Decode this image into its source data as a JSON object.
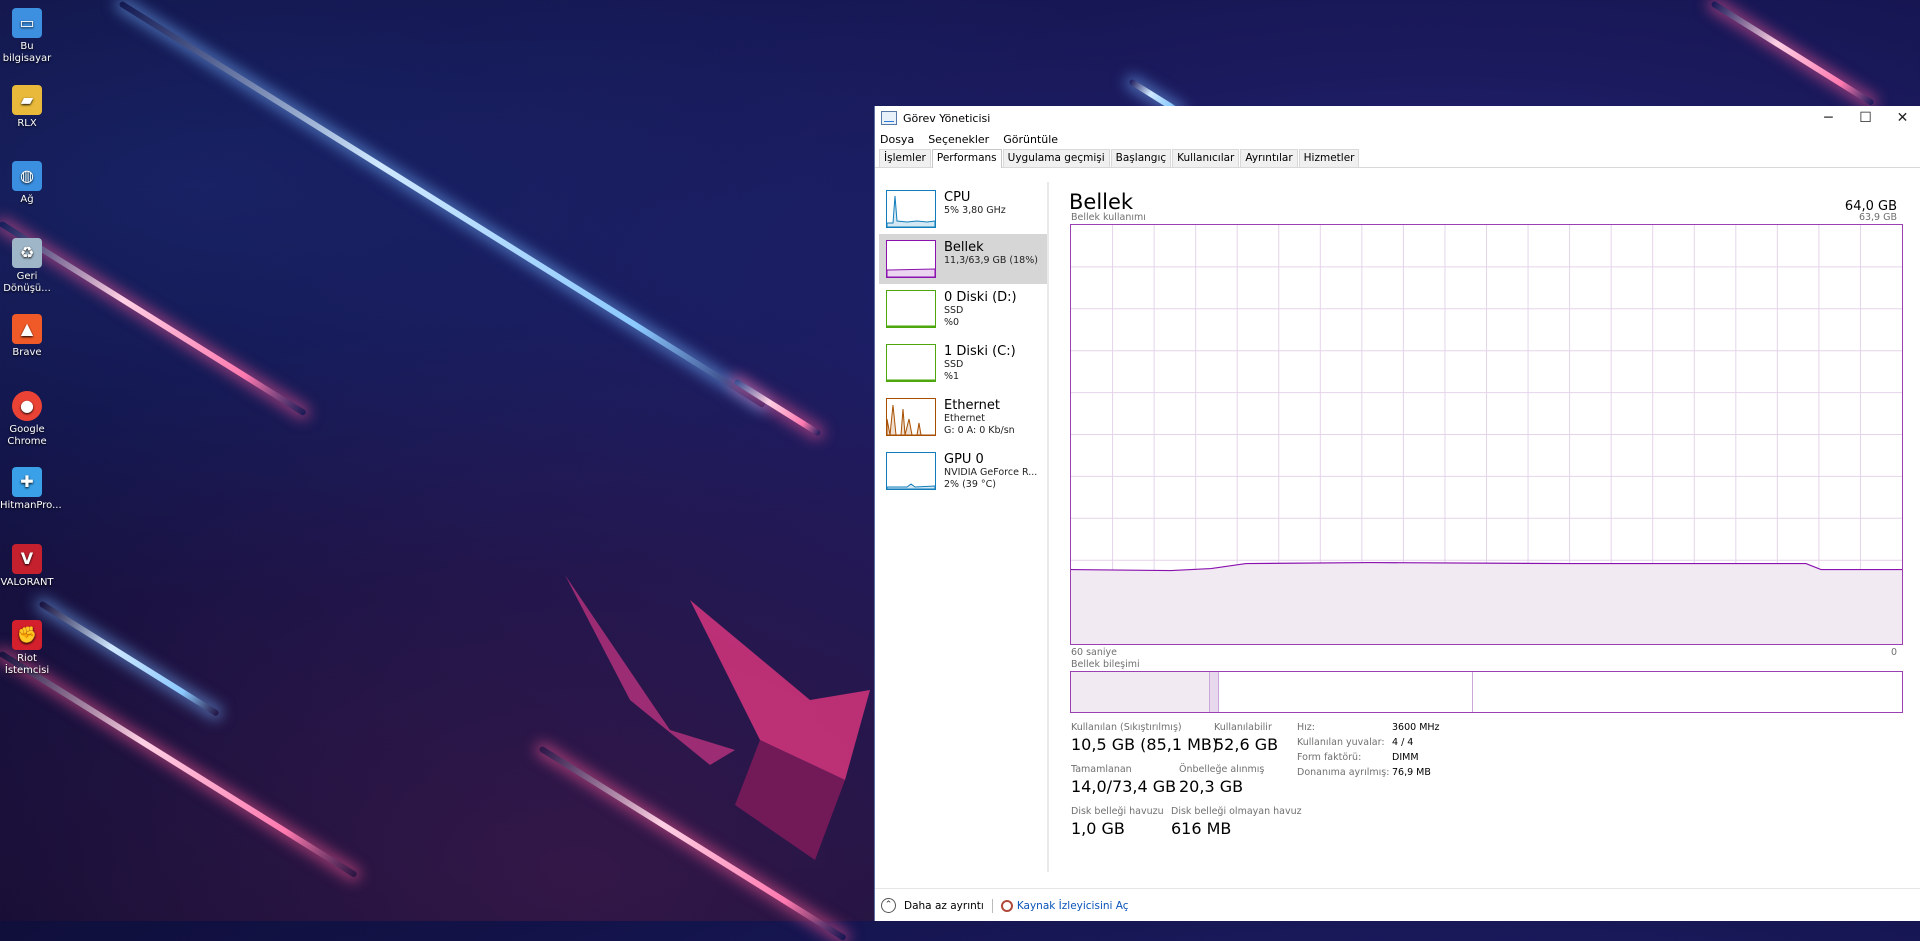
{
  "desktop": {
    "icons": [
      {
        "label": "Bu bilgisayar",
        "icon": "computer-icon",
        "color": "#3d8fe0"
      },
      {
        "label": "RLX",
        "icon": "user-folder-icon",
        "color": "#e8b93a"
      },
      {
        "label": "Ağ",
        "icon": "network-icon",
        "color": "#3b8fe0"
      },
      {
        "label": "Geri Dönüşü...",
        "icon": "recycle-bin-icon",
        "color": "#9fb6c8"
      },
      {
        "label": "Brave",
        "icon": "brave-icon",
        "color": "#f05a28"
      },
      {
        "label": "Google Chrome",
        "icon": "chrome-icon",
        "color": "#ea4335"
      },
      {
        "label": "HitmanPro...",
        "icon": "hitmanpro-icon",
        "color": "#3aa0e8"
      },
      {
        "label": "VALORANT",
        "icon": "valorant-icon",
        "color": "#c5202e"
      },
      {
        "label": "Riot İstemcisi",
        "icon": "riot-client-icon",
        "color": "#d3202c"
      }
    ]
  },
  "window": {
    "title": "Görev Yöneticisi",
    "minimize": "─",
    "maximize": "☐",
    "close": "✕"
  },
  "menu": [
    "Dosya",
    "Seçenekler",
    "Görüntüle"
  ],
  "tabs": [
    "İşlemler",
    "Performans",
    "Uygulama geçmişi",
    "Başlangıç",
    "Kullanıcılar",
    "Ayrıntılar",
    "Hizmetler"
  ],
  "active_tab": "Performans",
  "resources": [
    {
      "name": "CPU",
      "line1": "5% 3,80 GHz",
      "line2": "",
      "color": "#117dbb",
      "selected": false
    },
    {
      "name": "Bellek",
      "line1": "11,3/63,9 GB (18%)",
      "line2": "",
      "color": "#8b12ae",
      "selected": true
    },
    {
      "name": "0 Diski (D:)",
      "line1": "SSD",
      "line2": "%0",
      "color": "#4da60c",
      "selected": false
    },
    {
      "name": "1 Diski (C:)",
      "line1": "SSD",
      "line2": "%1",
      "color": "#4da60c",
      "selected": false
    },
    {
      "name": "Ethernet",
      "line1": "Ethernet",
      "line2": "G: 0 A: 0 Kb/sn",
      "color": "#a74f01",
      "selected": false
    },
    {
      "name": "GPU 0",
      "line1": "NVIDIA GeForce R...",
      "line2": "2% (39 °C)",
      "color": "#117dbb",
      "selected": false
    }
  ],
  "memory": {
    "title": "Bellek",
    "total": "64,0 GB",
    "usage_label": "Bellek kullanımı",
    "usage_max": "63,9 GB",
    "axis_left": "60 saniye",
    "axis_right": "0",
    "composition_label": "Bellek bileşimi",
    "usage_fraction": 0.18,
    "stats": {
      "in_use_label": "Kullanılan (Sıkıştırılmış)",
      "in_use_value": "10,5 GB (85,1 MB)",
      "available_label": "Kullanılabilir",
      "available_value": "52,6 GB",
      "committed_label": "Tamamlanan",
      "committed_value": "14,0/73,4 GB",
      "cached_label": "Önbelleğe alınmış",
      "cached_value": "20,3 GB",
      "paged_label": "Disk belleği havuzu",
      "paged_value": "1,0 GB",
      "nonpaged_label": "Disk belleği olmayan havuz",
      "nonpaged_value": "616 MB"
    },
    "specs": [
      {
        "label": "Hız:",
        "value": "3600 MHz"
      },
      {
        "label": "Kullanılan yuvalar:",
        "value": "4 / 4"
      },
      {
        "label": "Form faktörü:",
        "value": "DIMM"
      },
      {
        "label": "Donanıma ayrılmış:",
        "value": "76,9 MB"
      }
    ]
  },
  "footer": {
    "fewer_details": "Daha az ayrıntı",
    "open_resource_monitor": "Kaynak İzleyicisini Aç"
  },
  "colors": {
    "memory": "#8b12ae",
    "grid": "#e4d4ea",
    "fill": "#f1eaf3"
  }
}
